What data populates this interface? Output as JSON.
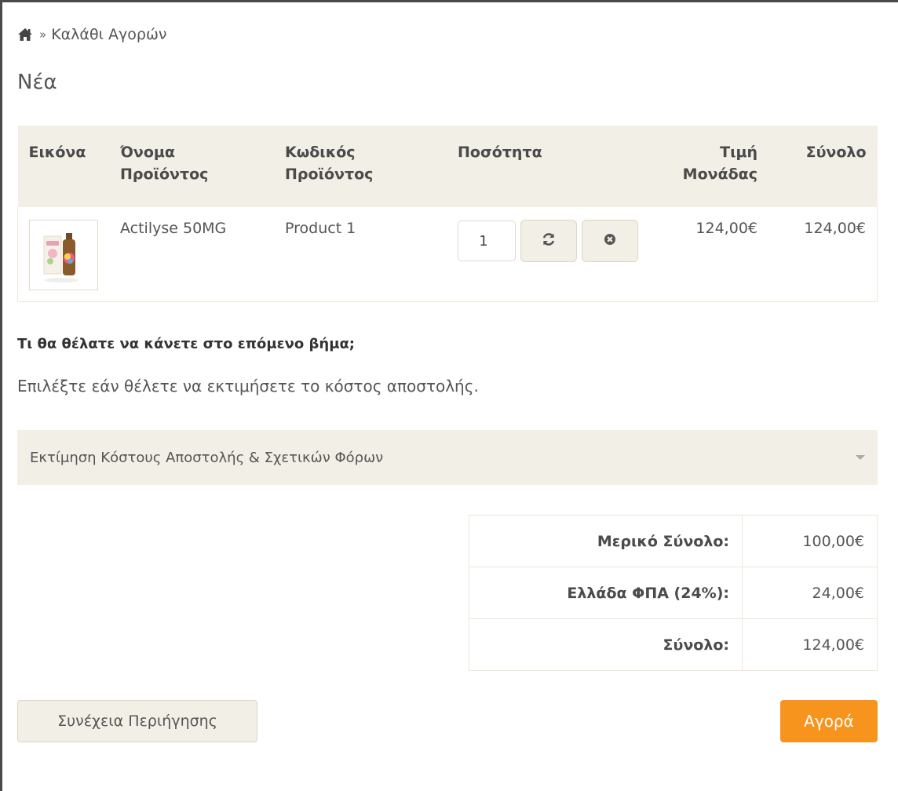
{
  "breadcrumb": {
    "separator": "»",
    "current": "Καλάθι Αγορών",
    "home_icon": "home-icon"
  },
  "page_title": "Νέα",
  "cart_table": {
    "headers": {
      "image": "Εικόνα",
      "name_line1": "Όνομα",
      "name_line2": "Προϊόντος",
      "code_line1": "Κωδικός",
      "code_line2": "Προϊόντος",
      "quantity": "Ποσότητα",
      "unit_price_line1": "Τιμή",
      "unit_price_line2": "Μονάδας",
      "total": "Σύνολο"
    },
    "rows": [
      {
        "name": "Actilyse 50MG",
        "code": "Product 1",
        "quantity": "1",
        "unit_price": "124,00€",
        "total": "124,00€",
        "update_icon": "refresh-icon",
        "remove_icon": "remove-circle-icon"
      }
    ]
  },
  "next_step": {
    "heading": "Τι θα θέλατε να κάνετε στο επόμενο βήμα;",
    "description": "Επιλέξτε εάν θέλετε να εκτιμήσετε το κόστος αποστολής."
  },
  "shipping_estimate": {
    "label": "Εκτίμηση Κόστους Αποστολής & Σχετικών Φόρων",
    "icon": "caret-down-icon"
  },
  "totals": [
    {
      "label": "Μερικό Σύνολο:",
      "value": "100,00€"
    },
    {
      "label": "Ελλάδα ΦΠΑ (24%):",
      "value": "24,00€"
    },
    {
      "label": "Σύνολο:",
      "value": "124,00€"
    }
  ],
  "buttons": {
    "continue_label": "Συνέχεια Περιήγησης",
    "buy_label": "Αγορά"
  },
  "colors": {
    "accent": "#f7941d",
    "panel": "#f2efe6",
    "border": "#eee7d8"
  }
}
